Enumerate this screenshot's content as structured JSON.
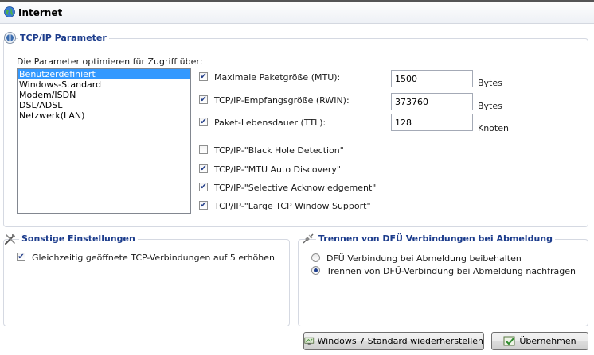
{
  "window": {
    "title": "Internet",
    "title_icon": "globe-icon"
  },
  "tcpip": {
    "group_title": "TCP/IP Parameter",
    "group_icon": "network-globe-icon",
    "optimize_label": "Die Parameter optimieren für Zugriff über:",
    "profiles": [
      "Benutzerdefiniert",
      "Windows-Standard",
      "Modem/ISDN",
      "DSL/ADSL",
      "Netzwerk(LAN)"
    ],
    "selected_profile": "Benutzerdefiniert",
    "mtu": {
      "label": "Maximale Paketgröße (MTU):",
      "checked": true,
      "value": "1500",
      "unit": "Bytes"
    },
    "rwin": {
      "label": "TCP/IP-Empfangsgröße (RWIN):",
      "checked": true,
      "value": "373760",
      "unit": "Bytes"
    },
    "ttl": {
      "label": "Paket-Lebensdauer (TTL):",
      "checked": true,
      "value": "128",
      "unit": "Knoten"
    },
    "options": [
      {
        "label": "TCP/IP-\"Black Hole Detection\"",
        "checked": false
      },
      {
        "label": "TCP/IP-\"MTU Auto Discovery\"",
        "checked": true
      },
      {
        "label": "TCP/IP-\"Selective Acknowledgement\"",
        "checked": true
      },
      {
        "label": "TCP/IP-\"Large TCP Window Support\"",
        "checked": true
      }
    ]
  },
  "sonstige": {
    "group_title": "Sonstige Einstellungen",
    "group_icon": "tools-icon",
    "limit_connections": {
      "label": "Gleichzeitig geöffnete TCP-Verbindungen auf 5 erhöhen",
      "checked": true
    }
  },
  "dfue": {
    "group_title": "Trennen von DFÜ Verbindungen bei Abmeldung",
    "group_icon": "disconnect-plug-icon",
    "options": [
      {
        "label": "DFÜ Verbindung bei Abmeldung beibehalten",
        "selected": false
      },
      {
        "label": "Trennen von DFÜ-Verbindung bei Abmeldung nachfragen",
        "selected": true
      }
    ]
  },
  "buttons": {
    "restore": "Windows 7 Standard wiederherstellen",
    "apply": "Übernehmen"
  },
  "colors": {
    "group_title": "#1c3c8c",
    "selection": "#3399ff",
    "check": "#243f8a"
  }
}
